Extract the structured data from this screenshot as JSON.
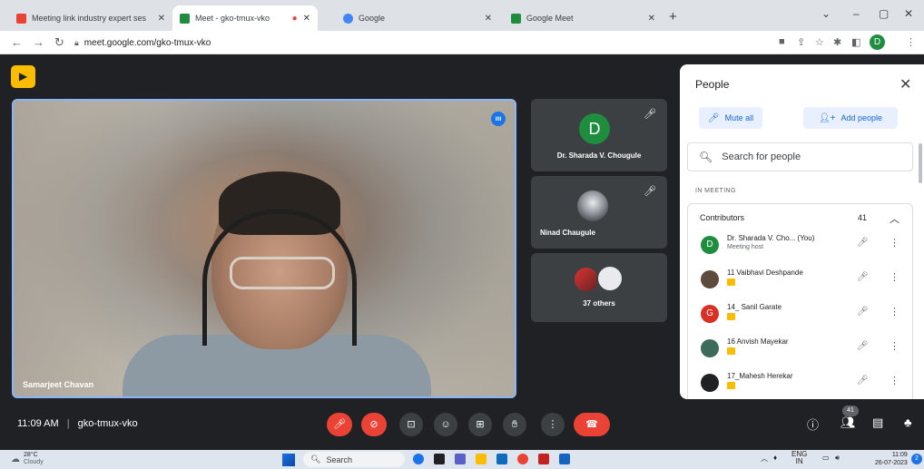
{
  "browser": {
    "tabs": [
      {
        "title": "Meeting link industry expert ses",
        "favicon_color": "#ea4335"
      },
      {
        "title": "Meet - gko-tmux-vko",
        "favicon_color": "#1e8e3e"
      },
      {
        "title": "Google",
        "favicon_color": "#4285f4"
      },
      {
        "title": "Google Meet",
        "favicon_color": "#1e8e3e"
      }
    ],
    "url": "meet.google.com/gko-tmux-vko",
    "profile_initial": "D"
  },
  "meet": {
    "main_speaker": "Samarjeet Chavan",
    "tiles": [
      {
        "name": "Dr. Sharada V. Chougule",
        "initial": "D"
      },
      {
        "name": "Ninad Chaugule"
      },
      {
        "name": "37 others"
      }
    ],
    "time": "11:09 AM",
    "separator": "|",
    "meeting_code": "gko-tmux-vko",
    "participant_badge": "41"
  },
  "people": {
    "title": "People",
    "mute_all": "Mute all",
    "add_people": "Add people",
    "search_placeholder": "Search for people",
    "in_meeting": "IN MEETING",
    "contributors_label": "Contributors",
    "contributors_count": "41",
    "list": [
      {
        "name": "Dr. Sharada V. Cho... (You)",
        "sub": "Meeting host",
        "initial": "D",
        "color": "#1e8e3e"
      },
      {
        "name": "11 Vaibhavi Deshpande",
        "initial": "",
        "color": "#5f4b3e"
      },
      {
        "name": "14_ Sanil Garate",
        "initial": "G",
        "color": "#d93025"
      },
      {
        "name": "16 Anvish Mayekar",
        "initial": "",
        "color": "#3c6b5c"
      },
      {
        "name": "17_Mahesh Herekar",
        "initial": "",
        "color": "#202124"
      }
    ]
  },
  "taskbar": {
    "temperature": "28°C",
    "weather": "Cloudy",
    "search": "Search",
    "lang": "ENG",
    "region": "IN",
    "time": "11:09",
    "date": "26-07-2023"
  },
  "colors": {
    "accent": "#1a73e8",
    "danger": "#ea4335",
    "meet_bg": "#202124",
    "tile_bg": "#3c4043"
  }
}
